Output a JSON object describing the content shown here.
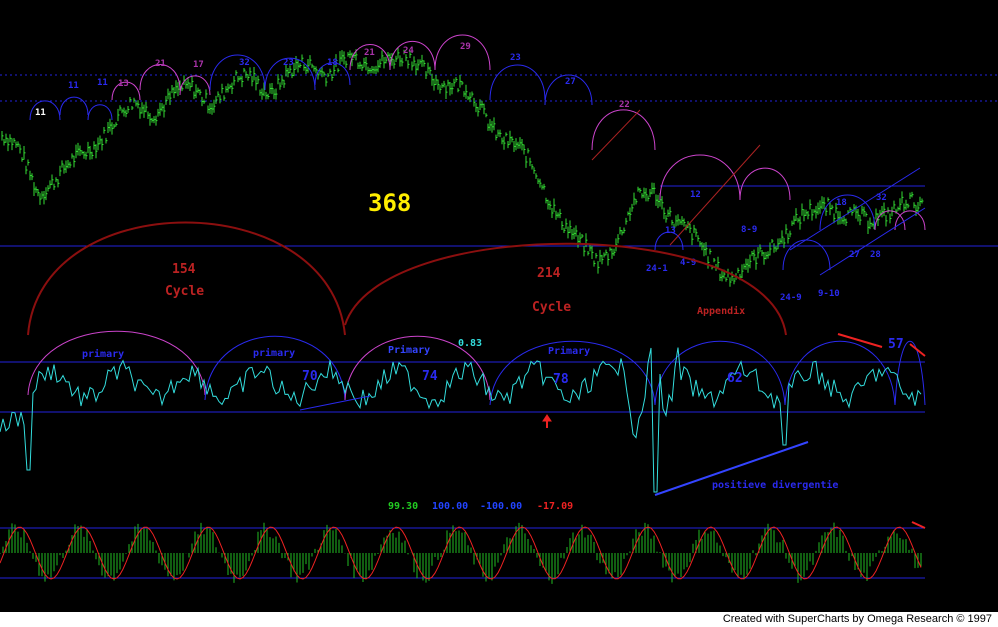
{
  "colors": {
    "background": "#000000",
    "price_bars": "#33dd33",
    "oscillator": "#33dddd",
    "guide_lines": "#2222dd",
    "cycle_arc_major": "#8b0f0f",
    "cycle_arc_magenta": "#cc44cc",
    "cycle_arc_blue": "#2a2aee",
    "histogram": "#22bb22",
    "signal_line": "#ee2222",
    "big_number": "#ffee00",
    "divergence_line": "#3344ff",
    "trendline_red": "#ee2222"
  },
  "header": {
    "big_label": "368"
  },
  "footer": {
    "credit": "Created with SuperCharts by Omega Research © 1997"
  },
  "chart_data": [
    {
      "panel": "price",
      "type": "bar",
      "description_source": "OHLC bar chart with overlaid cycle arcs",
      "cycle_labels": [
        "11",
        "11",
        "11",
        "13",
        "21",
        "17",
        "32",
        "23",
        "18",
        "21",
        "24",
        "29",
        "23",
        "27",
        "22",
        "13",
        "12",
        "8-9",
        "24-1",
        "4-9",
        "24-9",
        "9-10",
        "27",
        "28",
        "18",
        "32"
      ],
      "annotations": [
        "24-1",
        "4-9",
        "8-9",
        "24-9",
        "9-10",
        "27-28",
        "18",
        "32"
      ],
      "trend_notes": "Rises from low to a broad top, then declines and consolidates near the lower band",
      "relative_levels": [
        0.62,
        0.55,
        0.4,
        0.45,
        0.52,
        0.6,
        0.68,
        0.74,
        0.72,
        0.78,
        0.8,
        0.76,
        0.82,
        0.85,
        0.8,
        0.86,
        0.9,
        0.88,
        0.92,
        0.9,
        0.94,
        0.92,
        0.88,
        0.84,
        0.8,
        0.72,
        0.62,
        0.55,
        0.45,
        0.3,
        0.18,
        0.12,
        0.2,
        0.35,
        0.4,
        0.28,
        0.2,
        0.12,
        0.05,
        0.1,
        0.18,
        0.25,
        0.3,
        0.35,
        0.3,
        0.26,
        0.32,
        0.36,
        0.3
      ]
    },
    {
      "panel": "oscillator",
      "type": "line",
      "labels": {
        "cycle_154": "154",
        "cycle_154_word": "Cycle",
        "cycle_214": "214",
        "cycle_214_word": "Cycle",
        "appendix": "Appendix",
        "primary_1": "primary",
        "primary_2": "primary",
        "primary_3": "Primary",
        "primary_4": "Primary",
        "value_083": "0.83",
        "length_70": "70",
        "length_74": "74",
        "length_78": "78",
        "length_62": "62",
        "length_57": "57",
        "divergence": "positieve divergentie"
      },
      "reference_lines": [
        "upper",
        "lower"
      ]
    },
    {
      "panel": "histogram",
      "type": "bar",
      "readout": [
        "99.30",
        "100.00",
        "-100.00",
        "-17.09"
      ],
      "readout_colors": [
        "#22cc22",
        "#2244ff",
        "#2244ff",
        "#ee2222"
      ],
      "range": [
        -100,
        100
      ]
    }
  ]
}
